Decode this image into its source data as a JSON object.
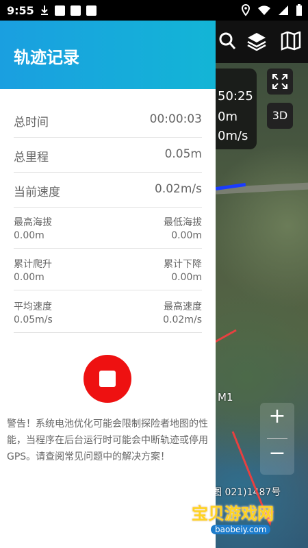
{
  "status_bar": {
    "time": "9:55",
    "icons": [
      "download-icon",
      "app-a-icon",
      "book-icon",
      "book-icon"
    ],
    "right_icons": [
      "location-icon",
      "wifi-icon",
      "signal-icon",
      "battery-icon"
    ]
  },
  "map": {
    "info_partial": [
      "50:25",
      "0m",
      "0m/s"
    ],
    "btn_3d": "3D",
    "zoom_in": "+",
    "zoom_out": "−",
    "label_m1": "M1",
    "attribution": "图 021)1487号"
  },
  "drawer": {
    "title": "轨迹记录",
    "rows": [
      {
        "label": "总时间",
        "value": "00:00:03"
      },
      {
        "label": "总里程",
        "value": "0.05m"
      },
      {
        "label": "当前速度",
        "value": "0.02m/s"
      }
    ],
    "pairs": [
      {
        "left_label": "最高海拔",
        "left_value": "0.00m",
        "right_label": "最低海拔",
        "right_value": "0.00m"
      },
      {
        "left_label": "累计爬升",
        "left_value": "0.00m",
        "right_label": "累计下降",
        "right_value": "0.00m"
      },
      {
        "left_label": "平均速度",
        "left_value": "0.05m/s",
        "right_label": "最高速度",
        "right_value": "0.02m/s"
      }
    ],
    "warning": "警告！系统电池优化可能会限制探险者地图的性能，当程序在后台运行时可能会中断轨迹或停用GPS。请查阅常见问题中的解决方案！"
  },
  "watermark": {
    "text": "宝贝游戏网",
    "sub": "baobeiy.com"
  },
  "colors": {
    "header_gradient_start": "#1a9fe0",
    "header_gradient_end": "#13b5d6",
    "stop_button": "#ee1111",
    "track_line": "#1a3cff"
  }
}
